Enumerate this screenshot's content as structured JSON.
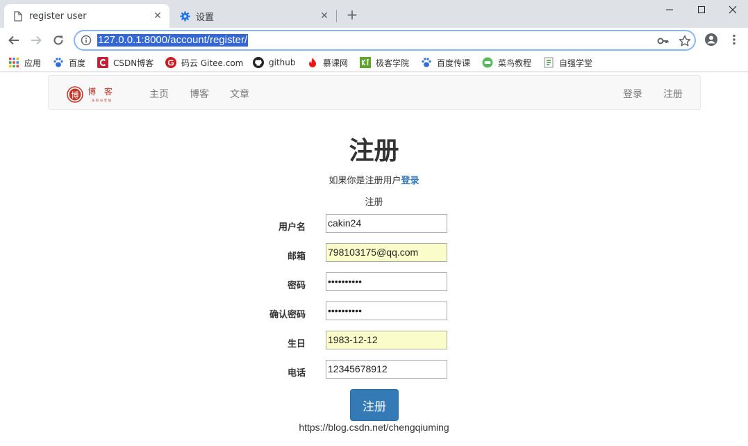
{
  "browser": {
    "tabs": [
      {
        "title": "register user",
        "active": true,
        "icon": "page-icon"
      },
      {
        "title": "设置",
        "active": false,
        "icon": "settings-gear-icon"
      }
    ],
    "new_tab_label": "+",
    "url": "127.0.0.1:8000/account/register/",
    "bookmarks": [
      {
        "label": "应用",
        "icon": "apps-grid-icon"
      },
      {
        "label": "百度",
        "icon": "baidu-paw-icon"
      },
      {
        "label": "CSDN博客",
        "icon": "csdn-icon"
      },
      {
        "label": "码云 Gitee.com",
        "icon": "gitee-icon"
      },
      {
        "label": "github",
        "icon": "github-icon"
      },
      {
        "label": "慕课网",
        "icon": "imooc-flame-icon"
      },
      {
        "label": "极客学院",
        "icon": "jikexueyuan-icon"
      },
      {
        "label": "百度传课",
        "icon": "baidu-paw-icon"
      },
      {
        "label": "菜鸟教程",
        "icon": "runoob-icon"
      },
      {
        "label": "自强学堂",
        "icon": "ziqiang-icon"
      }
    ],
    "accent_color": "#8ab4f8",
    "selection_color": "#3367d6"
  },
  "navbar": {
    "brand": {
      "char_main": "博",
      "chars_side": "博 客",
      "tagline": "乐 的 分 享 站"
    },
    "links_left": [
      "主页",
      "博客",
      "文章"
    ],
    "links_right": [
      "登录",
      "注册"
    ]
  },
  "main": {
    "heading": "注册",
    "hint_text": "如果你是注册用户",
    "hint_link": "登录",
    "form_caption": "注册",
    "fields": [
      {
        "label": "用户名",
        "value": "cakin24",
        "autofill": false,
        "type": "text"
      },
      {
        "label": "邮箱",
        "value": "798103175@qq.com",
        "autofill": true,
        "type": "text"
      },
      {
        "label": "密码",
        "value": "••••••••••",
        "autofill": false,
        "type": "password"
      },
      {
        "label": "确认密码",
        "value": "••••••••••",
        "autofill": false,
        "type": "password"
      },
      {
        "label": "生日",
        "value": "1983-12-12",
        "autofill": true,
        "type": "text"
      },
      {
        "label": "电话",
        "value": "12345678912",
        "autofill": false,
        "type": "text"
      }
    ],
    "submit_label": "注册",
    "button_color": "#337ab7"
  },
  "watermark": "https://blog.csdn.net/chengqiuming"
}
